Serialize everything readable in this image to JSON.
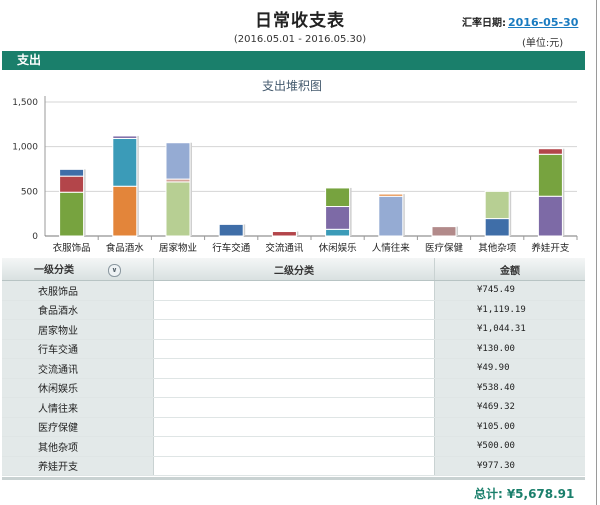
{
  "header": {
    "title": "日常收支表",
    "rate_label": "汇率日期:",
    "rate_date": "2016-05-30",
    "period": "(2016.05.01 - 2016.05.30)",
    "unit": "(单位:元)"
  },
  "section": {
    "title": "支出"
  },
  "chart_data": {
    "type": "bar",
    "stacked": true,
    "title": "支出堆积图",
    "categories": [
      "衣服饰品",
      "食品酒水",
      "居家物业",
      "行车交通",
      "交流通讯",
      "休闲娱乐",
      "人情往来",
      "医疗保健",
      "其他杂项",
      "养娃开支"
    ],
    "ylim": [
      0,
      1500
    ],
    "yticks": [
      "0",
      "500",
      "1,000",
      "1,500"
    ],
    "grid": true,
    "stacks": [
      [
        {
          "value": 490,
          "color": "#77a33f"
        },
        {
          "value": 180,
          "color": "#b3454a"
        },
        {
          "value": 76,
          "color": "#3f6ea8"
        }
      ],
      [
        {
          "value": 557,
          "color": "#e3853a"
        },
        {
          "value": 535,
          "color": "#3b9bb8"
        },
        {
          "value": 28,
          "color": "#7d6aa6"
        }
      ],
      [
        {
          "value": 605,
          "color": "#b7cf93"
        },
        {
          "value": 32,
          "color": "#d6a59b"
        },
        {
          "value": 407,
          "color": "#95abd3"
        }
      ],
      [
        {
          "value": 130,
          "color": "#3f6ea8"
        }
      ],
      [
        {
          "value": 50,
          "color": "#b3454a"
        }
      ],
      [
        {
          "value": 75,
          "color": "#3b9bb8"
        },
        {
          "value": 255,
          "color": "#7d6aa6"
        },
        {
          "value": 208,
          "color": "#77a33f"
        }
      ],
      [
        {
          "value": 445,
          "color": "#95abd3"
        },
        {
          "value": 24,
          "color": "#e3853a"
        }
      ],
      [
        {
          "value": 105,
          "color": "#b28a8a"
        }
      ],
      [
        {
          "value": 195,
          "color": "#3f6ea8"
        },
        {
          "value": 305,
          "color": "#b7cf93"
        }
      ],
      [
        {
          "value": 445,
          "color": "#7d6aa6"
        },
        {
          "value": 470,
          "color": "#77a33f"
        },
        {
          "value": 62,
          "color": "#b3454a"
        }
      ]
    ]
  },
  "table": {
    "headers": {
      "level1": "一级分类",
      "level2": "二级分类",
      "amount": "金额"
    },
    "rows": [
      {
        "category": "衣服饰品",
        "sub": "",
        "amount": "¥745.49"
      },
      {
        "category": "食品酒水",
        "sub": "",
        "amount": "¥1,119.19"
      },
      {
        "category": "居家物业",
        "sub": "",
        "amount": "¥1,044.31"
      },
      {
        "category": "行车交通",
        "sub": "",
        "amount": "¥130.00"
      },
      {
        "category": "交流通讯",
        "sub": "",
        "amount": "¥49.90"
      },
      {
        "category": "休闲娱乐",
        "sub": "",
        "amount": "¥538.40"
      },
      {
        "category": "人情往来",
        "sub": "",
        "amount": "¥469.32"
      },
      {
        "category": "医疗保健",
        "sub": "",
        "amount": "¥105.00"
      },
      {
        "category": "其他杂项",
        "sub": "",
        "amount": "¥500.00"
      },
      {
        "category": "养娃开支",
        "sub": "",
        "amount": "¥977.30"
      }
    ]
  },
  "footer": {
    "total_label": "总计:",
    "total_value": "¥5,678.91"
  }
}
